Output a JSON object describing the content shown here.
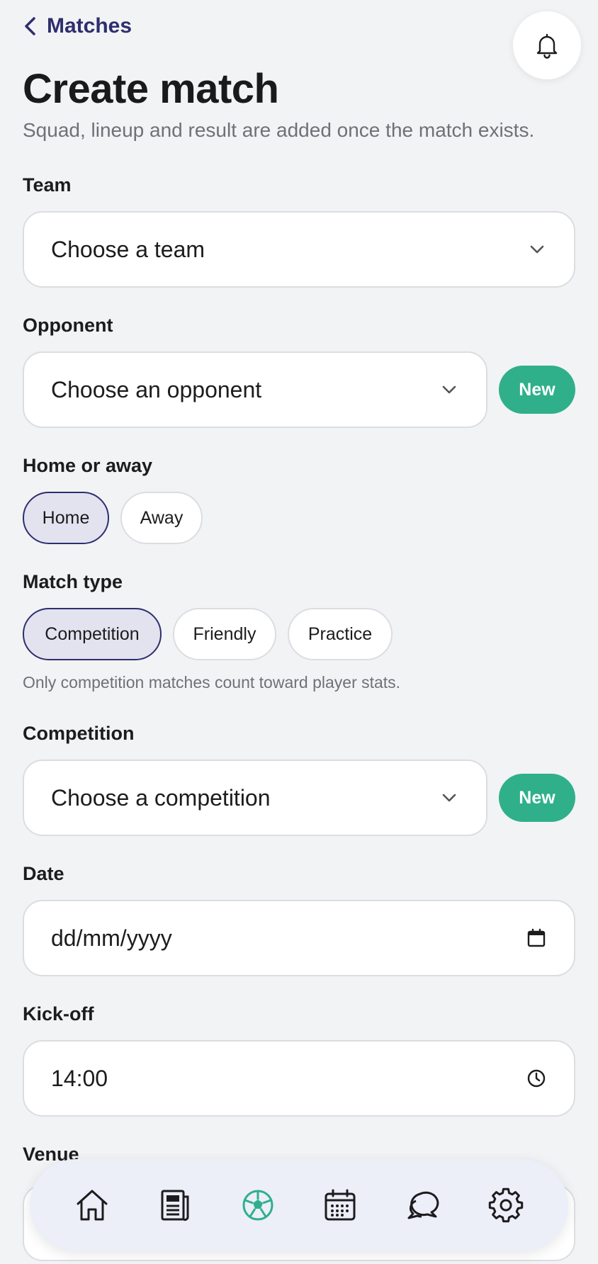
{
  "header": {
    "back_label": "Matches",
    "title": "Create match",
    "subtitle": "Squad, lineup and result are added once the match exists."
  },
  "form": {
    "team": {
      "label": "Team",
      "value": "Choose a team"
    },
    "opponent": {
      "label": "Opponent",
      "value": "Choose an opponent",
      "new_label": "New"
    },
    "home_away": {
      "label": "Home or away",
      "options": [
        "Home",
        "Away"
      ],
      "selected": "Home"
    },
    "match_type": {
      "label": "Match type",
      "options": [
        "Competition",
        "Friendly",
        "Practice"
      ],
      "selected": "Competition",
      "hint": "Only competition matches count toward player stats."
    },
    "competition": {
      "label": "Competition",
      "value": "Choose a competition",
      "new_label": "New"
    },
    "date": {
      "label": "Date",
      "value": "dd/mm/yyyy"
    },
    "kickoff": {
      "label": "Kick-off",
      "value": "14:00"
    },
    "venue": {
      "label": "Venue"
    }
  },
  "nav": {
    "items": [
      "home-icon",
      "news-icon",
      "football-icon",
      "calendar-icon",
      "chat-icon",
      "settings-icon"
    ],
    "active": "football-icon"
  },
  "colors": {
    "accent": "#2e2e6e",
    "green": "#2fb08a",
    "background": "#f2f3f5"
  }
}
